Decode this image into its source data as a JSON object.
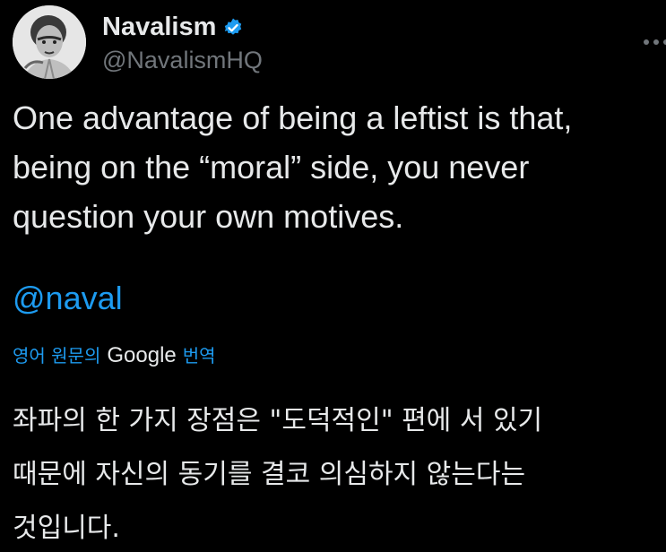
{
  "author": {
    "display_name": "Navalism",
    "handle": "@NavalismHQ"
  },
  "icons": {
    "avatar": "portrait-avatar",
    "verified": "verified-badge-icon",
    "more": "more-options-icon"
  },
  "tweet": {
    "text": "One advantage of being a leftist is that,\nbeing on the “moral” side, you never\nquestion your own motives.",
    "mention": "@naval"
  },
  "translation": {
    "prefix": "영어 원문의",
    "provider": "Google",
    "suffix": "번역",
    "text": "좌파의 한 가지 장점은 \"도덕적인\" 편에 서 있기\n때문에 자신의 동기를 결코 의심하지 않는다는\n것입니다."
  },
  "colors": {
    "background": "#000000",
    "text": "#e7e9ea",
    "secondary": "#71767b",
    "accent": "#1d9bf0"
  }
}
